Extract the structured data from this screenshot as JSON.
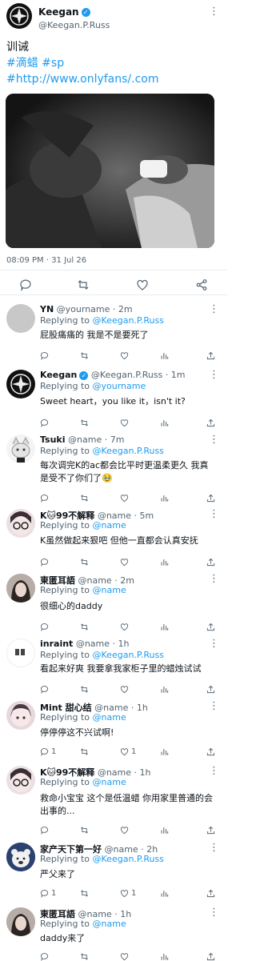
{
  "post": {
    "author": "Keegan",
    "handle": "@Keegan.P.Russ",
    "text_line1": "训诫",
    "hashtags": "#滴蜡 #sp",
    "link": "#http://www.onlyfans/.com",
    "timestamp": "08:09 PM · 31 Jul 26"
  },
  "replies": [
    {
      "name": "YN",
      "handle": "@yourname",
      "time": "· 2m",
      "replying": "Replying to",
      "to": "@Keegan.P.Russ",
      "text": "屁股痛痛的 我是不是要死了",
      "comments": "",
      "retweets": "",
      "likes": ""
    },
    {
      "name": "Keegan",
      "handle": "@Keegan.P.Russ",
      "time": "· 1m",
      "replying": "Replying to",
      "to": "@yourname",
      "text": "Sweet heart，you like it，isn't it?",
      "comments": "",
      "retweets": "",
      "likes": ""
    },
    {
      "name": "Tsuki",
      "handle": "@name",
      "time": "· 7m",
      "replying": "Replying to",
      "to": "@Keegan.P.Russ",
      "text": "每次调完K的ac都会比平时更温柔更久 我真是受不了你们了🥹",
      "comments": "",
      "retweets": "",
      "likes": ""
    },
    {
      "name": "K🐱99不解释",
      "handle": "@name",
      "time": "· 5m",
      "replying": "Replying to",
      "to": "@name",
      "text": "K虽然做起来狠吧 但他一直都会认真安抚",
      "comments": "",
      "retweets": "",
      "likes": ""
    },
    {
      "name": "東匿耳語",
      "handle": "@name",
      "time": "· 2m",
      "replying": "Replying to",
      "to": "@name",
      "text": "很细心的daddy",
      "comments": "",
      "retweets": "",
      "likes": ""
    },
    {
      "name": "inraint",
      "handle": "@name",
      "time": "· 1h",
      "replying": "Replying to",
      "to": "@Keegan.P.Russ",
      "text": "看起来好爽 我要拿我家柜子里的蜡烛试试",
      "comments": "",
      "retweets": "",
      "likes": ""
    },
    {
      "name": "Mint 甜心结",
      "handle": "@name",
      "time": "· 1h",
      "replying": "Replying to",
      "to": "@name",
      "text": "停停停这不兴试啊!",
      "comments": "1",
      "retweets": "",
      "likes": "1"
    },
    {
      "name": "K🐱99不解释",
      "handle": "@name",
      "time": "· 1h",
      "replying": "Replying to",
      "to": "@name",
      "text": "救命小宝宝 这个是低温蜡 你用家里普通的会出事的...",
      "comments": "",
      "retweets": "",
      "likes": ""
    },
    {
      "name": "家产天下第一好",
      "handle": "@name",
      "time": "· 2h",
      "replying": "Replying to",
      "to": "@Keegan.P.Russ",
      "text": "严父来了",
      "comments": "1",
      "retweets": "",
      "likes": "1"
    },
    {
      "name": "東匿耳語",
      "handle": "@name",
      "time": "· 1h",
      "replying": "Replying to",
      "to": "@name",
      "text": "daddy来了",
      "comments": "",
      "retweets": "",
      "likes": ""
    }
  ],
  "colors": {
    "accent": "#1d9bf0",
    "text": "#0f1419",
    "muted": "#536471",
    "divider": "#e6ecf0"
  }
}
